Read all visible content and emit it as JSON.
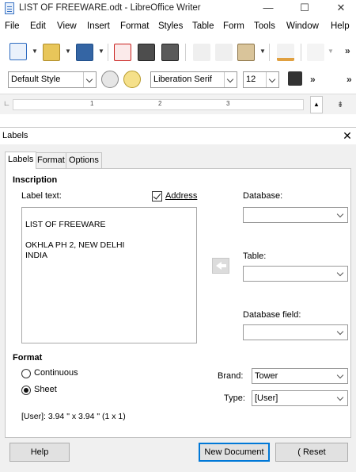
{
  "window": {
    "title": "LIST OF FREEWARE.odt - LibreOffice Writer",
    "controls": {
      "minimize": "—",
      "maximize": "☐",
      "close": "✕"
    }
  },
  "menu": [
    "File",
    "Edit",
    "View",
    "Insert",
    "Format",
    "Styles",
    "Table",
    "Form",
    "Tools",
    "Window",
    "Help"
  ],
  "toolbar2": {
    "paragraph_style": "Default Style",
    "font_name": "Liberation Serif",
    "font_size": "12",
    "more": "»"
  },
  "ruler": {
    "labels": [
      "1",
      "2",
      "3"
    ]
  },
  "dialog": {
    "title": "Labels",
    "close": "✕",
    "tabs": [
      "Labels",
      "Format",
      "Options"
    ],
    "inscription": {
      "heading": "Inscription",
      "label_text_label": "Label text:",
      "address_label": "Address",
      "address_checked": true,
      "label_text_lines": [
        "",
        "LIST OF FREEWARE",
        "",
        "OKHLA PH 2, NEW DELHI",
        "INDIA"
      ]
    },
    "database": {
      "database_label": "Database:",
      "database_value": "",
      "table_label": "Table:",
      "table_value": "",
      "field_label": "Database field:",
      "field_value": ""
    },
    "format": {
      "heading": "Format",
      "continuous_label": "Continuous",
      "sheet_label": "Sheet",
      "selected": "Sheet",
      "brand_label": "Brand:",
      "brand_value": "Tower",
      "type_label": "Type:",
      "type_value": "[User]",
      "size_info": "[User]: 3.94 \" x 3.94 \" (1 x 1)"
    },
    "buttons": {
      "help": "Help",
      "new_document": "New Document",
      "reset": "Reset",
      "reset_prefix": "("
    }
  },
  "colors": {
    "accent": "#0078d7",
    "dialog_bg": "#f0f0f0",
    "arrow_button": "#dcdcdc"
  }
}
